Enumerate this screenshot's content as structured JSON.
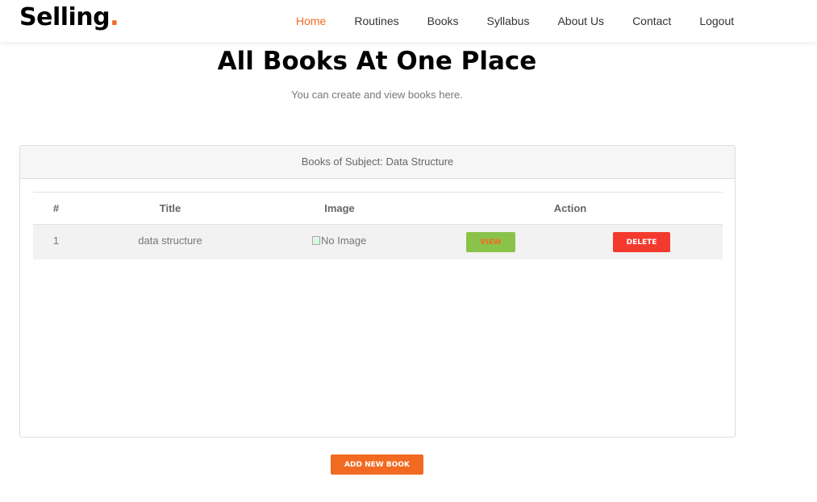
{
  "brand": {
    "name": "Selling",
    "dot": "."
  },
  "nav": {
    "items": [
      "Home",
      "Routines",
      "Books",
      "Syllabus",
      "About Us",
      "Contact",
      "Logout"
    ],
    "active": "Home"
  },
  "page": {
    "title": "All Books At One Place",
    "subtitle": "You can create and view books here."
  },
  "card": {
    "header": "Books of Subject: Data Structure",
    "columns": [
      "#",
      "Title",
      "Image",
      "Action"
    ],
    "rows": [
      {
        "num": "1",
        "title": "data structure",
        "image_alt": "No Image",
        "view_label": "VIEW",
        "delete_label": "DELETE"
      }
    ]
  },
  "add_button": "ADD NEW BOOK",
  "colors": {
    "accent": "#f26a21",
    "view": "#8bc34a",
    "delete": "#f33a2e"
  }
}
